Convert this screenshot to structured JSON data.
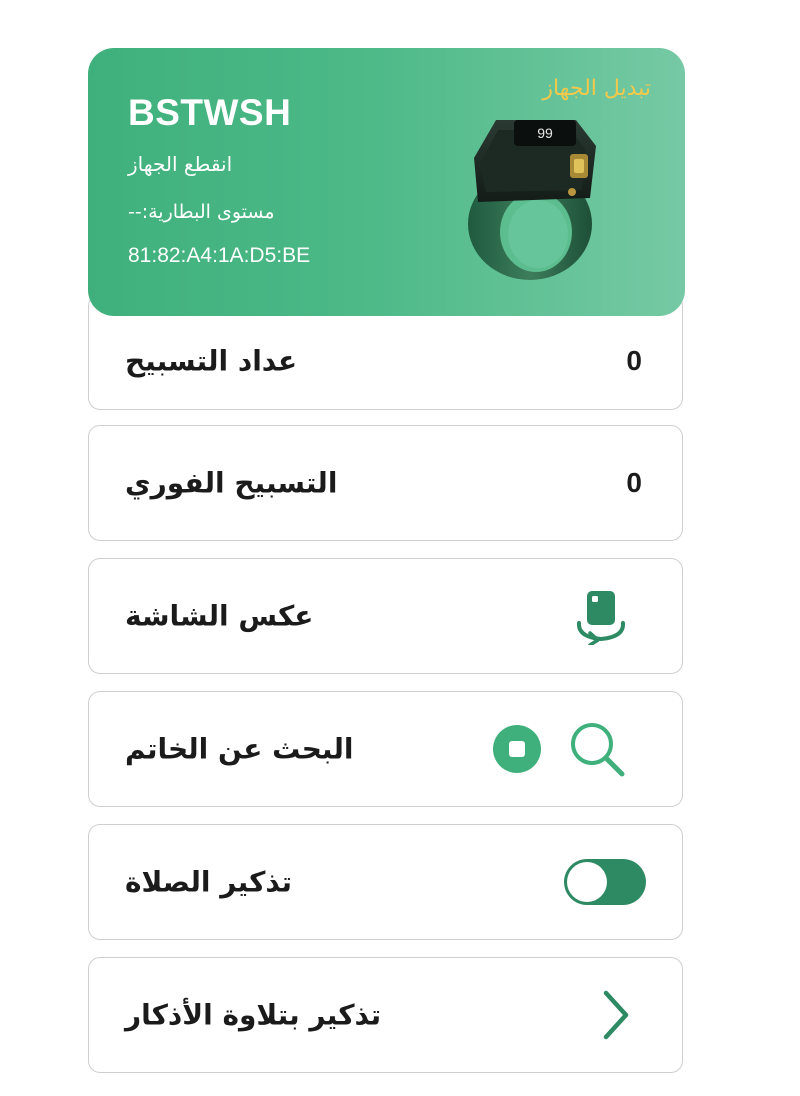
{
  "device": {
    "name": "BSTWSH",
    "status": "انقطع الجهاز",
    "battery": "مستوى البطارية:--",
    "mac": "81:82:A4:1A:D5:BE",
    "switch_label": "تبديل الجهاز",
    "ring_display": "99"
  },
  "rows": {
    "tasbih_counter": {
      "label": "عداد التسبيح",
      "value": "0"
    },
    "instant_tasbih": {
      "label": "التسبيح الفوري",
      "value": "0"
    },
    "flip_screen": {
      "label": "عكس الشاشة",
      "icon": "flip-screen-icon"
    },
    "find_ring": {
      "label": "البحث عن الخاتم",
      "icons": [
        "stop-icon",
        "search-icon"
      ]
    },
    "prayer_reminder": {
      "label": "تذكير الصلاة",
      "toggle_on": true
    },
    "dhikr_reminder": {
      "label": "تذكير بتلاوة الأذكار",
      "icon": "chevron-right-icon"
    }
  },
  "colors": {
    "accent": "#3fb07c",
    "accent_dark": "#2e8a62",
    "switch_text": "#f2c94c"
  }
}
